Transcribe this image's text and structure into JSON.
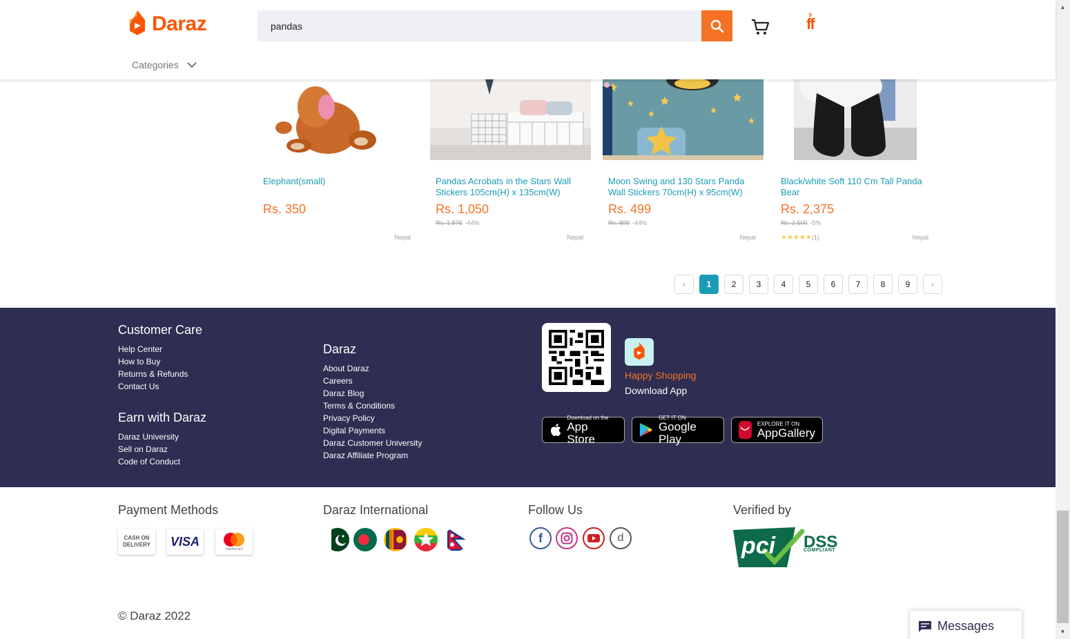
{
  "header": {
    "logo_text": "Daraz",
    "search_value": "pandas",
    "categories_label": "Categories",
    "promo_top": "ɔ",
    "promo_main": "ff"
  },
  "products": [
    {
      "title": "Elephant(small)",
      "price": "Rs. 350",
      "original_price": "",
      "discount": "",
      "location": "Nepal",
      "rating_stars": "",
      "rating_count": ""
    },
    {
      "title": "Pandas Acrobats in the Stars Wall Stickers 105cm(H) x 135cm(W)",
      "price": "Rs. 1,050",
      "original_price": "Rs. 1,875",
      "discount": "-44%",
      "location": "Nepal",
      "rating_stars": "",
      "rating_count": ""
    },
    {
      "title": "Moon Swing and 130 Stars Panda Wall Stickers 70cm(H) x 95cm(W)",
      "price": "Rs. 499",
      "original_price": "Rs. 899",
      "discount": "-44%",
      "location": "Nepal",
      "rating_stars": "",
      "rating_count": ""
    },
    {
      "title": "Black/white Soft 110 Cm Tall Panda Bear",
      "price": "Rs. 2,375",
      "original_price": "Rs. 2,500",
      "discount": "-5%",
      "location": "Nepal",
      "rating_stars": "★★★★★",
      "rating_count": "(1)"
    }
  ],
  "pagination": {
    "prev": "‹",
    "pages": [
      "1",
      "2",
      "3",
      "4",
      "5",
      "6",
      "7",
      "8",
      "9"
    ],
    "current": "1",
    "next": "›"
  },
  "footer": {
    "customer_care": {
      "heading": "Customer Care",
      "links": [
        "Help Center",
        "How to Buy",
        "Returns & Refunds",
        "Contact Us"
      ]
    },
    "earn": {
      "heading": "Earn with Daraz",
      "links": [
        "Daraz University",
        "Sell on Daraz",
        "Code of Conduct"
      ]
    },
    "daraz": {
      "heading": "Daraz",
      "links": [
        "About Daraz",
        "Careers",
        "Daraz Blog",
        "Terms & Conditions",
        "Privacy Policy",
        "Digital Payments",
        "Daraz Customer University",
        "Daraz Affiliate Program"
      ]
    },
    "app": {
      "happy": "Happy Shopping",
      "download": "Download App"
    },
    "stores": [
      {
        "small": "Download on the",
        "big": "App Store"
      },
      {
        "small": "GET IT ON",
        "big": "Google Play"
      },
      {
        "small": "EXPLORE IT ON",
        "big": "AppGallery"
      }
    ],
    "payment_heading": "Payment Methods",
    "payments": [
      "CASH ON DELIVERY",
      "VISA",
      "mastercard"
    ],
    "international_heading": "Daraz International",
    "follow_heading": "Follow Us",
    "verified_heading": "Verified by",
    "pci": {
      "left": "pci",
      "right1": "DSS",
      "right2": "COMPLIANT"
    },
    "copyright": "© Daraz 2022"
  },
  "messages": {
    "label": "Messages"
  },
  "colors": {
    "brand": "#f85606",
    "accent": "#f57224",
    "link": "#1a9cb7",
    "footer_bg": "#2e2d52"
  }
}
